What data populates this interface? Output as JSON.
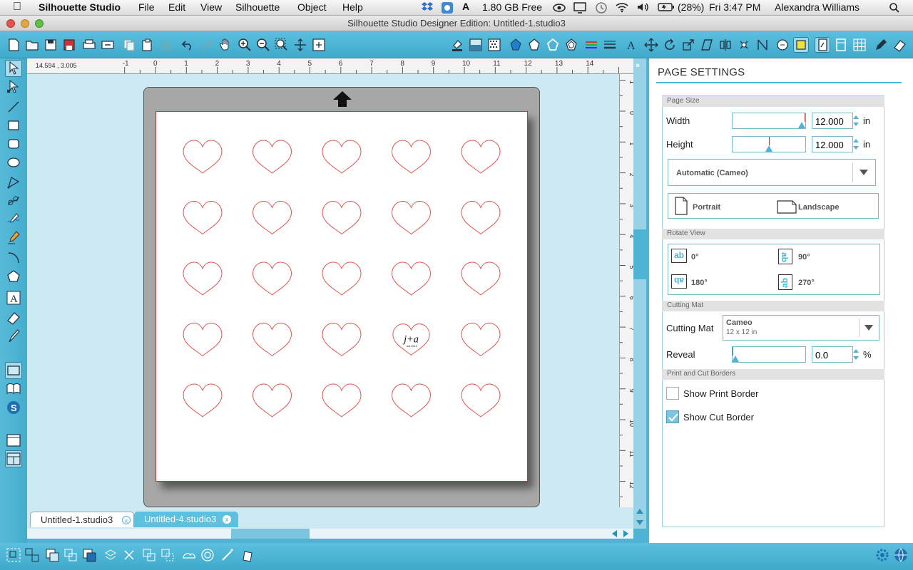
{
  "menubar": {
    "app_name": "Silhouette Studio",
    "menus": [
      "File",
      "Edit",
      "View",
      "Silhouette",
      "Object",
      "Help"
    ],
    "status": {
      "disk_free": "1.80 GB Free",
      "battery": "(28%)",
      "clock": "Fri 3:47 PM",
      "user": "Alexandra Williams"
    }
  },
  "window": {
    "title": "Silhouette Studio Designer Edition: Untitled-1.studio3"
  },
  "canvas": {
    "coord_readout": "14.594 , 3.005",
    "hruler_labels": [
      "-1",
      "0",
      "1",
      "2",
      "3",
      "4",
      "5",
      "6",
      "7",
      "8",
      "9",
      "10",
      "11",
      "12",
      "13",
      "14"
    ],
    "vruler_labels": [
      "1",
      "0",
      "1",
      "2",
      "3",
      "4",
      "5",
      "6",
      "7",
      "8",
      "9",
      "10",
      "11",
      "12",
      "13"
    ],
    "hearts": {
      "rows": 5,
      "cols": 5,
      "stroke_color": "#e0554e"
    },
    "monogram": {
      "text": "j+a",
      "subtext": "est.2013",
      "row": 4,
      "col": 4
    }
  },
  "tabs": [
    {
      "label": "Untitled-1.studio3",
      "close": "x",
      "active": true
    },
    {
      "label": "Untitled-4.studio3",
      "close": "x",
      "active": false
    }
  ],
  "panel": {
    "title": "PAGE SETTINGS",
    "page_size": {
      "header": "Page Size",
      "width_label": "Width",
      "width_value": "12.000",
      "height_label": "Height",
      "height_value": "12.000",
      "unit": "in",
      "width_slider_fraction": 1.0,
      "height_slider_fraction": 0.5,
      "media": "Automatic (Cameo)",
      "portrait": "Portrait",
      "landscape": "Landscape"
    },
    "rotate_view": {
      "header": "Rotate View",
      "r0": "0°",
      "r90": "90°",
      "r180": "180°",
      "r270": "270°",
      "icon_text": "ab"
    },
    "cutting_mat": {
      "header": "Cutting Mat",
      "label": "Cutting Mat",
      "name": "Cameo",
      "size": "12 x 12 in",
      "reveal_label": "Reveal",
      "reveal_value": "0.0",
      "reveal_unit": "%",
      "reveal_fraction": 0.0
    },
    "borders": {
      "header": "Print and Cut Borders",
      "print": "Show Print Border",
      "print_checked": false,
      "cut": "Show Cut Border",
      "cut_checked": true
    }
  },
  "colors": {
    "accent": "#4fb3d3",
    "heart": "#e0554e",
    "mat": "#a7a7a7"
  }
}
